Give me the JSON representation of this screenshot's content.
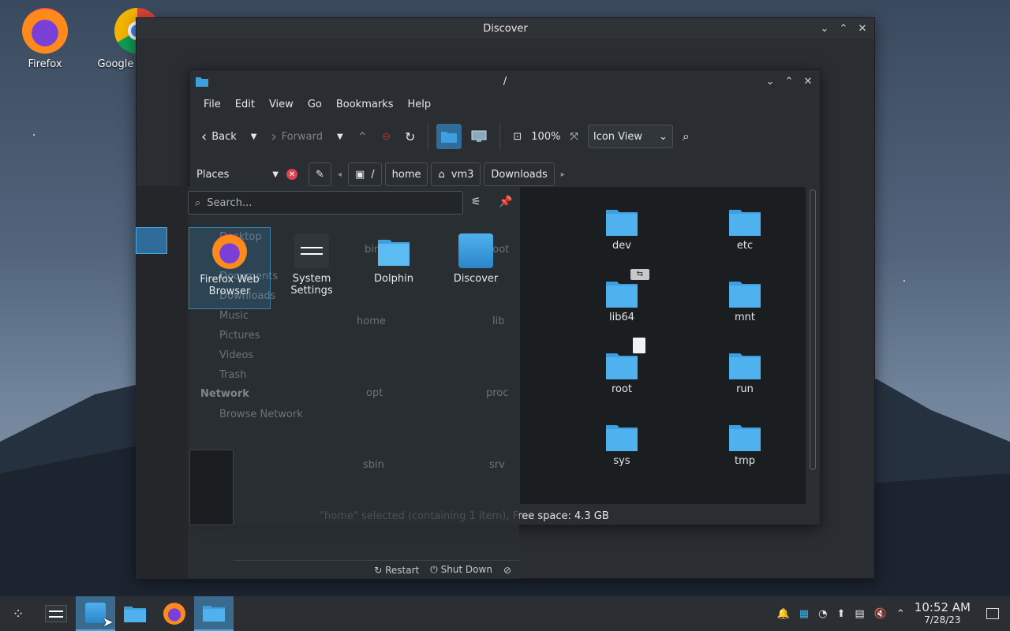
{
  "desktop": {
    "icons": [
      {
        "label": "Firefox",
        "icon": "firefox-icon"
      },
      {
        "label": "Google Chrome",
        "icon": "chrome-icon"
      }
    ]
  },
  "discover_window": {
    "title": "Discover",
    "controls": {
      "minimize": "⌄",
      "maximize": "⌃",
      "close": "✕"
    }
  },
  "dolphin": {
    "title": "/",
    "menu": [
      "File",
      "Edit",
      "View",
      "Go",
      "Bookmarks",
      "Help"
    ],
    "toolbar": {
      "back": "Back",
      "forward": "Forward",
      "zoom": "100%",
      "view_mode": "Icon View"
    },
    "places_label": "Places",
    "breadcrumbs": [
      "/",
      "home",
      "vm3",
      "Downloads"
    ],
    "folders": [
      {
        "name": "dev"
      },
      {
        "name": "etc"
      },
      {
        "name": "lib64"
      },
      {
        "name": "mnt"
      },
      {
        "name": "root"
      },
      {
        "name": "run"
      },
      {
        "name": "sys"
      },
      {
        "name": "tmp"
      }
    ],
    "status": "\"home\" selected (containing 1 item), Free space: 4.3 GB"
  },
  "launcher": {
    "search_placeholder": "Search...",
    "apps": [
      {
        "label": "Firefox Web Browser",
        "icon": "firefox-icon"
      },
      {
        "label": "System Settings",
        "icon": "settings-icon"
      },
      {
        "label": "Dolphin",
        "icon": "folder-icon"
      },
      {
        "label": "Discover",
        "icon": "discover-icon"
      }
    ],
    "faded_places": [
      "Desktop",
      "Documents",
      "Downloads",
      "Music",
      "Pictures",
      "Videos",
      "Trash"
    ],
    "network_heading": "Network",
    "browse_network": "Browse Network",
    "faded_folders": [
      "bin",
      "boot",
      "home",
      "lib",
      "opt",
      "proc",
      "sbin",
      "srv"
    ],
    "footer": {
      "restart": "Restart",
      "shutdown": "Shut Down"
    }
  },
  "taskbar": {
    "time": "10:52 AM",
    "date": "7/28/23"
  },
  "colors": {
    "accent": "#3daee9",
    "folder": "#3d9ee0"
  }
}
